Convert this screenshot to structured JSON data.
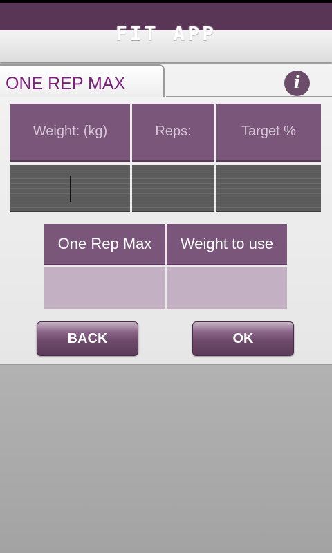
{
  "header": {
    "title": "FIT APP"
  },
  "tab": {
    "label": "ONE REP MAX"
  },
  "info": {
    "glyph": "i",
    "icon": "info-icon"
  },
  "inputs": {
    "weight_label": "Weight: (kg)",
    "reps_label": "Reps:",
    "target_label": "Target %",
    "weight_value": "",
    "reps_value": "",
    "target_value": ""
  },
  "results": {
    "one_rep_max_label": "One Rep Max",
    "weight_to_use_label": "Weight to use",
    "one_rep_max_value": "",
    "weight_to_use_value": ""
  },
  "buttons": {
    "back": "BACK",
    "ok": "OK"
  },
  "colors": {
    "brand": "#5a3656",
    "accent_text": "#7a1f7a",
    "cell": "#7a567a",
    "result_bg": "#c3b1c3"
  }
}
